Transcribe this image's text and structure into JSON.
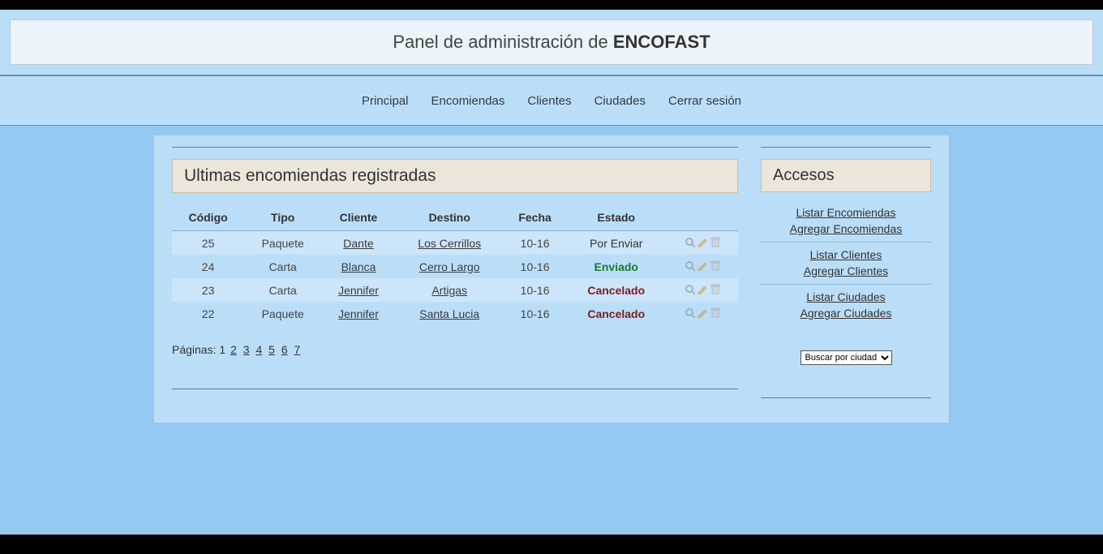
{
  "title": {
    "prefix": "Panel de administración de ",
    "brand": "ENCOFAST"
  },
  "nav": [
    "Principal",
    "Encomiendas",
    "Clientes",
    "Ciudades",
    "Cerrar sesión"
  ],
  "main": {
    "heading": "Ultimas encomiendas registradas",
    "columns": [
      "Código",
      "Tipo",
      "Cliente",
      "Destino",
      "Fecha",
      "Estado"
    ],
    "rows": [
      {
        "codigo": "25",
        "tipo": "Paquete",
        "cliente": "Dante",
        "destino": "Los Cerrillos",
        "fecha": "10-16",
        "estado": "Por Enviar",
        "estado_class": "status-porenviar",
        "alt": true
      },
      {
        "codigo": "24",
        "tipo": "Carta",
        "cliente": "Blanca",
        "destino": "Cerro Largo",
        "fecha": "10-16",
        "estado": "Enviado",
        "estado_class": "status-enviado",
        "alt": false
      },
      {
        "codigo": "23",
        "tipo": "Carta",
        "cliente": "Jennifer",
        "destino": "Artigas",
        "fecha": "10-16",
        "estado": "Cancelado",
        "estado_class": "status-cancelado",
        "alt": true
      },
      {
        "codigo": "22",
        "tipo": "Paquete",
        "cliente": "Jennifer",
        "destino": "Santa Lucia",
        "fecha": "10-16",
        "estado": "Cancelado",
        "estado_class": "status-cancelado",
        "alt": false
      }
    ],
    "pagination": {
      "label": "Páginas:",
      "current": "1",
      "pages": [
        "2",
        "3",
        "4",
        "5",
        "6",
        "7"
      ]
    }
  },
  "sidebar": {
    "heading": "Accesos",
    "groups": [
      [
        "Listar Encomiendas",
        "Agregar Encomiendas"
      ],
      [
        "Listar Clientes",
        "Agregar Clientes"
      ],
      [
        "Listar Ciudades",
        "Agregar Ciudades"
      ]
    ],
    "select_placeholder": "Buscar por ciudad"
  }
}
